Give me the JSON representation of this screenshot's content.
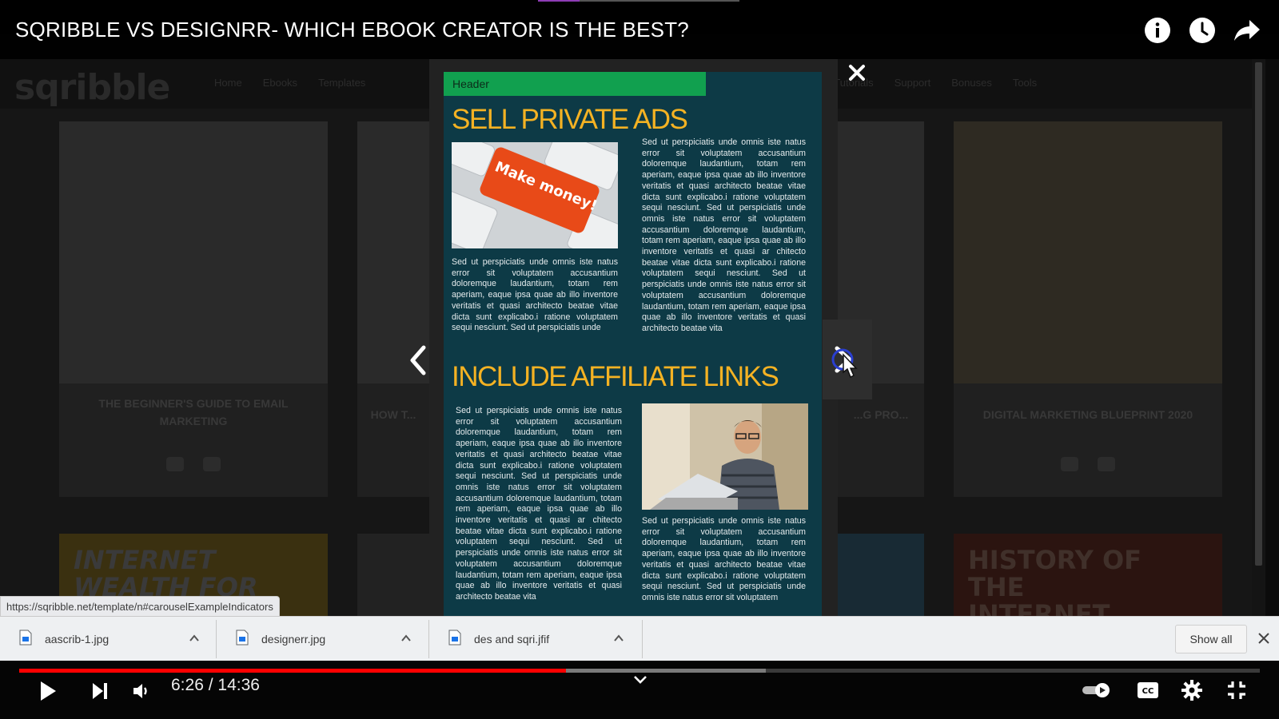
{
  "video": {
    "title": "SQRIBBLE VS DESIGNRR- WHICH EBOOK CREATOR IS THE BEST?",
    "current_time": "6:26",
    "separator": " / ",
    "duration": "14:36",
    "progress_fraction": 0.441,
    "buffered_fraction": 0.602
  },
  "top_icons": [
    "info-icon",
    "watch-later-icon",
    "share-icon"
  ],
  "background_page": {
    "logo": "sqribble",
    "nav_items": [
      "Home",
      "Ebooks",
      "Templates",
      "Tutorials",
      "Support",
      "Bonuses",
      "Tools"
    ],
    "cards": [
      {
        "title": "THE BEGINNER'S GUIDE TO EMAIL MARKETING"
      },
      {
        "title": "HOW T..."
      },
      {
        "title": "...G PRO..."
      },
      {
        "title": "DIGITAL MARKETING BLUEPRINT 2020"
      }
    ],
    "lower_titles": [
      "INTERNET WEALTH FOR DUMMIES",
      "HISTORY OF THE INTERNET"
    ]
  },
  "ebook": {
    "header_label": "Header",
    "section1_title": "SELL PRIVATE ADS",
    "section2_title": "INCLUDE AFFILIATE LINKS",
    "image1_caption": "Make money!",
    "lorem_a": "Sed ut perspiciatis unde omnis iste natus error sit voluptatem accusantium doloremque laudantium, totam rem aperiam, eaque ipsa quae ab illo inventore veritatis et quasi architecto beatae vitae dicta sunt explicabo.i ratione voluptatem sequi nesciunt. Sed ut perspiciatis unde omnis iste natus error sit voluptatem accusantium doloremque laudantium, totam rem aperiam, eaque ipsa quae ab illo inventore veritatis et quasi ar chitecto beatae vitae dicta sunt explicabo.i ratione voluptatem sequi nesciunt. Sed ut perspiciatis unde omnis iste natus error sit voluptatem accusantium doloremque laudantium, totam rem aperiam, eaque ipsa quae ab illo inventore veritatis et quasi architecto beatae vita",
    "lorem_b": "Sed ut perspiciatis unde omnis iste natus error sit voluptatem accusantium doloremque laudantium, totam rem aperiam, eaque ipsa quae ab illo inventore veritatis et quasi architecto beatae vitae dicta sunt explicabo.i ratione voluptatem sequi nesciunt. Sed ut perspiciatis unde",
    "lorem_c": "Sed ut perspiciatis unde omnis iste natus error sit voluptatem accusantium doloremque laudantium, totam rem aperiam, eaque ipsa quae ab illo inventore veritatis et quasi architecto beatae vitae dicta sunt explicabo.i ratione voluptatem sequi nesciunt. Sed ut perspiciatis unde omnis iste natus error sit voluptatem accusantium doloremque laudantium, totam rem aperiam, eaque ipsa quae ab illo inventore veritatis et quasi ar chitecto beatae vitae dicta sunt explicabo.i ratione voluptatem sequi nesciunt. Sed ut perspiciatis unde omnis iste natus error sit voluptatem accusantium doloremque laudantium, totam rem aperiam, eaque ipsa quae ab illo inventore veritatis et quasi architecto beatae vita",
    "lorem_d": "Sed ut perspiciatis unde omnis iste natus error sit voluptatem accusantium doloremque laudantium, totam rem aperiam, eaque ipsa quae ab illo inventore veritatis et quasi architecto beatae vitae dicta sunt explicabo.i ratione voluptatem sequi nesciunt. Sed ut perspiciatis unde omnis iste natus error sit voluptatem"
  },
  "status_url": "https://sqribble.net/template/n#carouselExampleIndicators",
  "downloads": {
    "items": [
      {
        "name": "aascrib-1.jpg"
      },
      {
        "name": "designerr.jpg"
      },
      {
        "name": "des and sqri.jfif"
      }
    ],
    "show_all_label": "Show all"
  },
  "colors": {
    "progress_played": "#ff0000",
    "ebook_bg": "#0d3a46",
    "ebook_title": "#f4b223",
    "header_green": "#11a04f"
  }
}
